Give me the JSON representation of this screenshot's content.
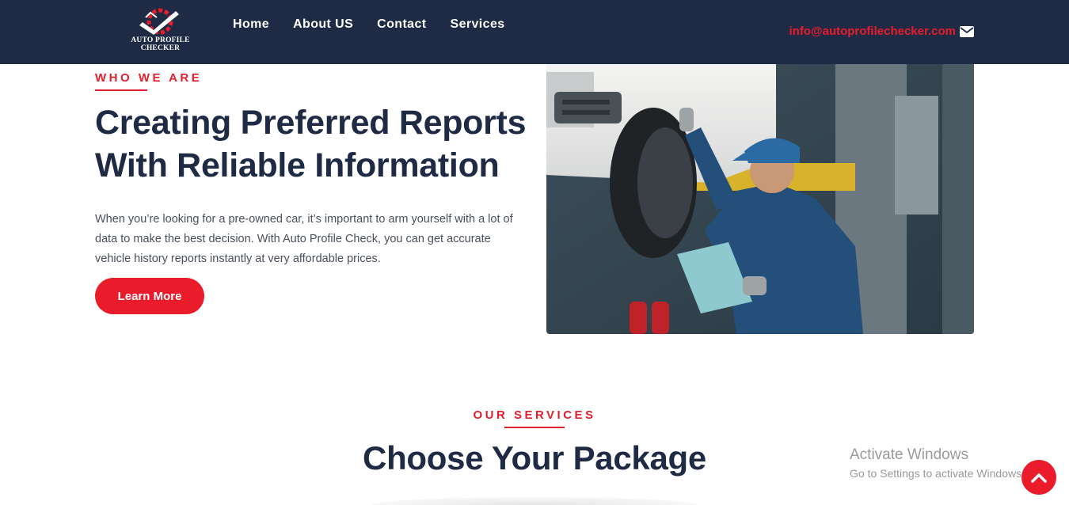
{
  "brand": {
    "logo_text_line1": "AUTO PROFILE",
    "logo_text_line2": "CHECKER",
    "accent_color": "#ea1c2c",
    "navy_color": "#1f2a44"
  },
  "nav": {
    "items": [
      {
        "label": "Home"
      },
      {
        "label": "About US"
      },
      {
        "label": "Contact"
      },
      {
        "label": "Services"
      }
    ]
  },
  "header": {
    "email": "info@autoprofilechecker.com",
    "email_icon": "envelope-icon"
  },
  "hero": {
    "eyebrow": "WHO WE ARE",
    "title": "Creating Preferred Reports With Reliable Information",
    "description": "When you’re looking for a pre-owned car, it’s important to arm yourself with a lot of data to make the best decision. With Auto Profile Check, you can get accurate vehicle history reports instantly at very affordable prices.",
    "cta_label": "Learn More",
    "image_subject": "mechanic-inspecting-car-on-lift"
  },
  "services": {
    "eyebrow": "OUR SERVICES",
    "title": "Choose Your Package"
  },
  "watermark": {
    "title": "Activate Windows",
    "subtitle": "Go to Settings to activate Windows."
  },
  "scroll_top_icon": "chevron-up-icon"
}
